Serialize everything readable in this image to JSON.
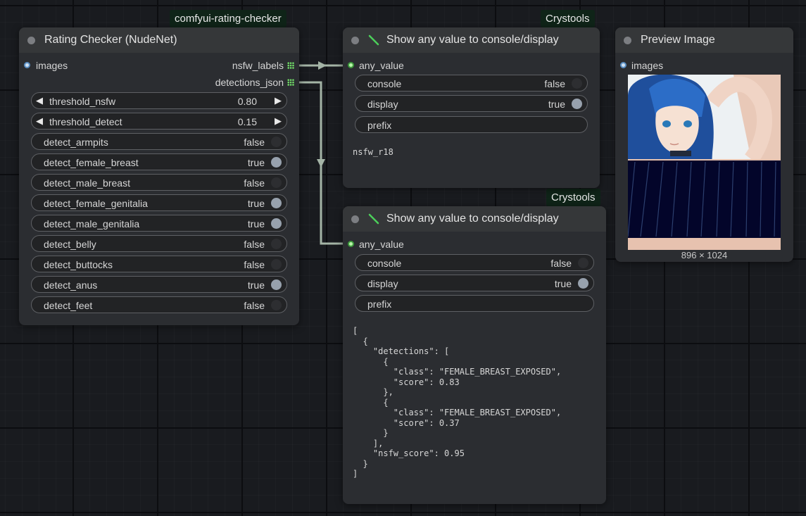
{
  "badges": {
    "rating_checker_pack": "comfyui-rating-checker",
    "crystools_1": "Crystools",
    "crystools_2": "Crystools"
  },
  "rating_node": {
    "title": "Rating Checker (NudeNet)",
    "input_label": "images",
    "output_1": "nsfw_labels",
    "output_2": "detections_json",
    "widgets": [
      {
        "label": "threshold_nsfw",
        "value": "0.80",
        "type": "number"
      },
      {
        "label": "threshold_detect",
        "value": "0.15",
        "type": "number"
      },
      {
        "label": "detect_armpits",
        "value": "false",
        "type": "toggle"
      },
      {
        "label": "detect_female_breast",
        "value": "true",
        "type": "toggle"
      },
      {
        "label": "detect_male_breast",
        "value": "false",
        "type": "toggle"
      },
      {
        "label": "detect_female_genitalia",
        "value": "true",
        "type": "toggle"
      },
      {
        "label": "detect_male_genitalia",
        "value": "true",
        "type": "toggle"
      },
      {
        "label": "detect_belly",
        "value": "false",
        "type": "toggle"
      },
      {
        "label": "detect_buttocks",
        "value": "false",
        "type": "toggle"
      },
      {
        "label": "detect_anus",
        "value": "true",
        "type": "toggle"
      },
      {
        "label": "detect_feet",
        "value": "false",
        "type": "toggle"
      }
    ]
  },
  "show_node_1": {
    "title": "Show any value to console/display",
    "input_label": "any_value",
    "console_label": "console",
    "console_value": "false",
    "display_label": "display",
    "display_value": "true",
    "prefix_label": "prefix",
    "output_text": "nsfw_r18"
  },
  "show_node_2": {
    "title": "Show any value to console/display",
    "input_label": "any_value",
    "console_label": "console",
    "console_value": "false",
    "display_label": "display",
    "display_value": "true",
    "prefix_label": "prefix",
    "output_text": "[\n  {\n    \"detections\": [\n      {\n        \"class\": \"FEMALE_BREAST_EXPOSED\",\n        \"score\": 0.83\n      },\n      {\n        \"class\": \"FEMALE_BREAST_EXPOSED\",\n        \"score\": 0.37\n      }\n    ],\n    \"nsfw_score\": 0.95\n  }\n]"
  },
  "preview_node": {
    "title": "Preview Image",
    "input_label": "images",
    "image_size": "896 × 1024"
  },
  "colors": {
    "canvas_bg": "#191b1f",
    "node_bg": "#2b2d31",
    "node_header": "#353739",
    "badge_bg": "#0f2418",
    "link": "#a4b4a6",
    "output_slot": "#74e36a"
  },
  "icons": {
    "title_icon": "green-slash-icon",
    "output_slot_icon": "grid-slot-icon"
  }
}
